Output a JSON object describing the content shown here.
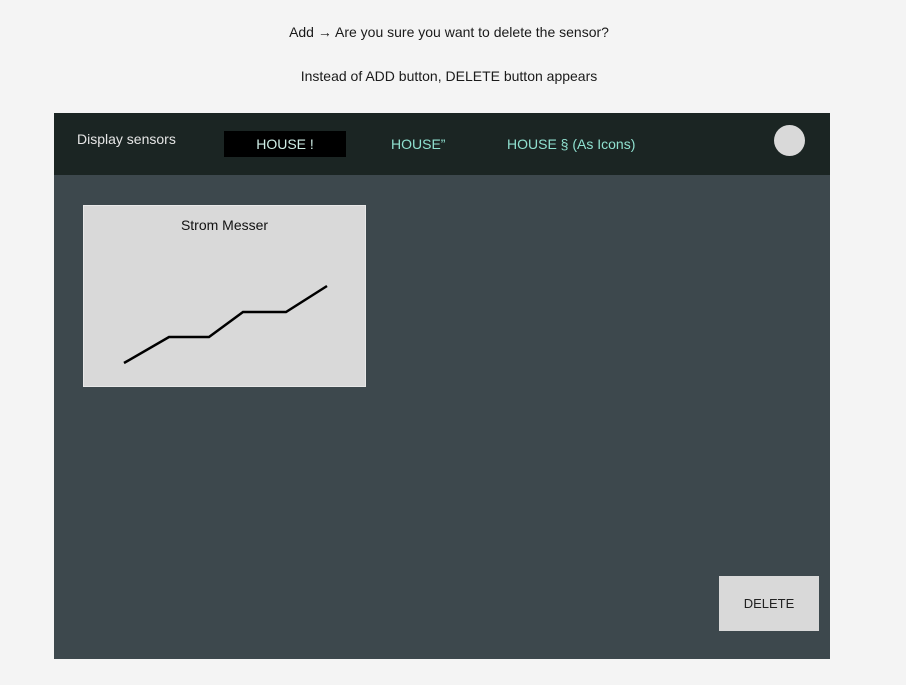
{
  "notes": {
    "line1": "Add → Are you sure you want to delete the sensor?",
    "line2": "Instead of ADD button, DELETE button appears"
  },
  "topbar": {
    "title": "Display sensors",
    "tabs": [
      {
        "label": "HOUSE !",
        "active": true
      },
      {
        "label": "HOUSE”",
        "active": false
      },
      {
        "label": "HOUSE § (As Icons)",
        "active": false
      }
    ]
  },
  "sensor_card": {
    "title": "Strom Messer"
  },
  "actions": {
    "delete_label": "DELETE"
  },
  "colors": {
    "page_background": "#f4f4f4",
    "frame_background": "#3d484d",
    "topbar_background": "#1b2523",
    "tab_text": "#8fe0cf",
    "card_background": "#d9d9d9"
  }
}
